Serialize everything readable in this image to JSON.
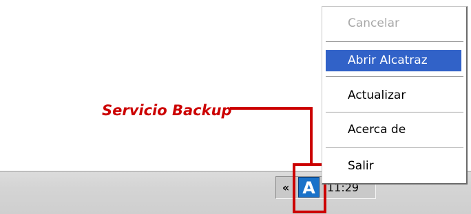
{
  "callout": {
    "label": "Servicio Backup"
  },
  "tray": {
    "chevron": "«",
    "app_icon_letter": "A",
    "clock": "11:29"
  },
  "context_menu": {
    "items": [
      {
        "label": "Cancelar",
        "state": "disabled"
      },
      {
        "label": "Abrir Alcatraz",
        "state": "selected"
      },
      {
        "label": "Actualizar",
        "state": "normal"
      },
      {
        "label": "Acerca de",
        "state": "normal"
      },
      {
        "label": "Salir",
        "state": "normal"
      }
    ]
  },
  "colors": {
    "callout_red": "#cc0000",
    "menu_highlight": "#3162c8",
    "app_icon_blue": "#1a72c9"
  }
}
